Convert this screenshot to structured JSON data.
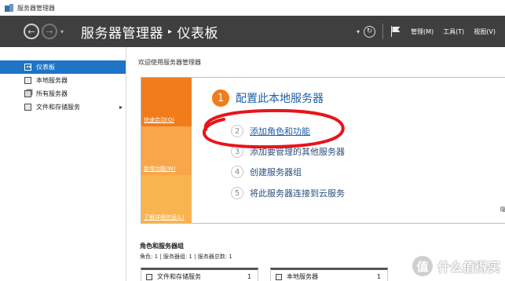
{
  "window": {
    "title": "服务器管理器"
  },
  "nav": {
    "breadcrumb_root": "服务器管理器",
    "separator": "▸",
    "breadcrumb_current": "仪表板",
    "menu": [
      {
        "label": "管理(M)"
      },
      {
        "label": "工具(T)"
      },
      {
        "label": "视图(V)"
      }
    ]
  },
  "sidebar": {
    "items": [
      {
        "label": "仪表板",
        "active": true,
        "icon": "dashboard-icon"
      },
      {
        "label": "本地服务器",
        "active": false,
        "icon": "server-icon"
      },
      {
        "label": "所有服务器",
        "active": false,
        "icon": "servers-icon"
      },
      {
        "label": "文件和存储服务",
        "active": false,
        "icon": "file-storage-icon",
        "has_children": true
      }
    ]
  },
  "main": {
    "welcome": "欢迎使用服务器管理器",
    "tiles": {
      "quick": "快速启动(Q)",
      "new": "新增功能(W)",
      "more": "了解详细信息(L)"
    },
    "steps": [
      {
        "num": "1",
        "label": "配置此本地服务器"
      },
      {
        "num": "2",
        "label": "添加角色和功能"
      },
      {
        "num": "3",
        "label": "添加要管理的其他服务器"
      },
      {
        "num": "4",
        "label": "创建服务器组"
      },
      {
        "num": "5",
        "label": "将此服务器连接到云服务"
      }
    ],
    "hide_label": "隐",
    "roles": {
      "title": "角色和服务器组",
      "summary": "角色: 1 | 服务器组: 1 | 服务器总数: 1",
      "cards": [
        {
          "name": "文件和存储服务",
          "count": "1"
        },
        {
          "name": "本地服务器",
          "count": "1"
        }
      ]
    }
  },
  "watermark": {
    "logo": "值",
    "text": "什么值得买"
  },
  "colors": {
    "nav_bg": "#3f3f3f",
    "active_blue": "#1e74c5",
    "tile_orange": "#f07c1c",
    "tile_light_orange": "#f7a64a",
    "link_blue": "#1d5ea8",
    "annotation_red": "#e8141b"
  }
}
